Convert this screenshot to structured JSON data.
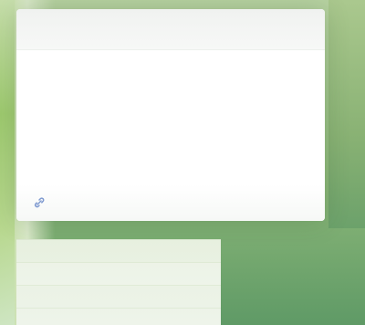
{
  "colors": {
    "backdrop_start": "#b7d2a1",
    "backdrop_end": "#5f9a66",
    "dialog_bg": "#ffffff",
    "panel_bg": "#e7f0df",
    "link": "#7f9ad0"
  },
  "dialog": {
    "title": "",
    "body": "",
    "footer_action": "",
    "footer_icon": "link-icon"
  },
  "panel": {
    "rows": [
      {
        "label": "",
        "value": ""
      },
      {
        "label": "",
        "value": ""
      },
      {
        "label": "",
        "value": ""
      }
    ]
  }
}
